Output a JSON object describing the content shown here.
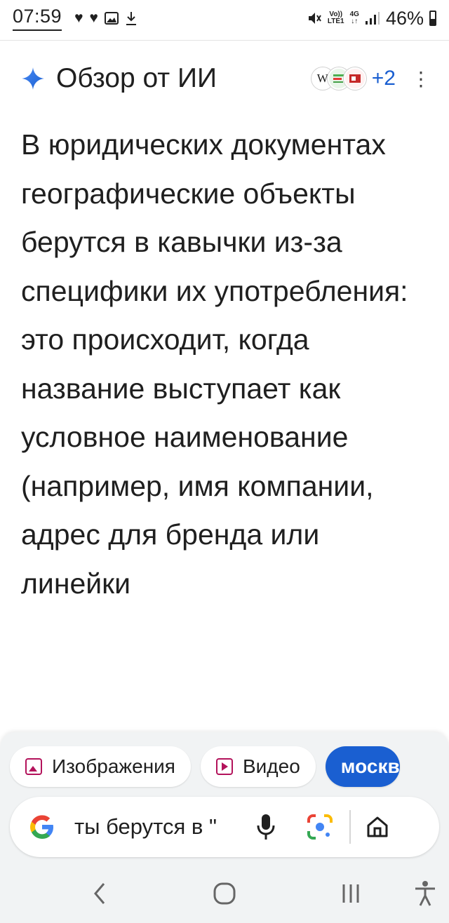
{
  "status_bar": {
    "time": "07:59",
    "volte_top": "Vo))",
    "volte_bottom": "LTE1",
    "network": "4G",
    "battery_percent": "46%",
    "battery_level": 0.46
  },
  "ai_overview": {
    "title": "Обзор от ИИ",
    "source_w": "W",
    "sources_more": "+2",
    "body": "В юридических документах географические объекты берутся в кавычки из-за специфики их употребления: это происходит, когда название выступает как условное наименование (например, имя компании, адрес для бренда или линейки"
  },
  "chips": [
    {
      "label": "Изображения"
    },
    {
      "label": "Видео"
    },
    {
      "label": "москв"
    }
  ],
  "search": {
    "query": "ты берутся в \""
  },
  "colors": {
    "accent": "#1a5fd1",
    "chip_icon": "#b3135b"
  }
}
